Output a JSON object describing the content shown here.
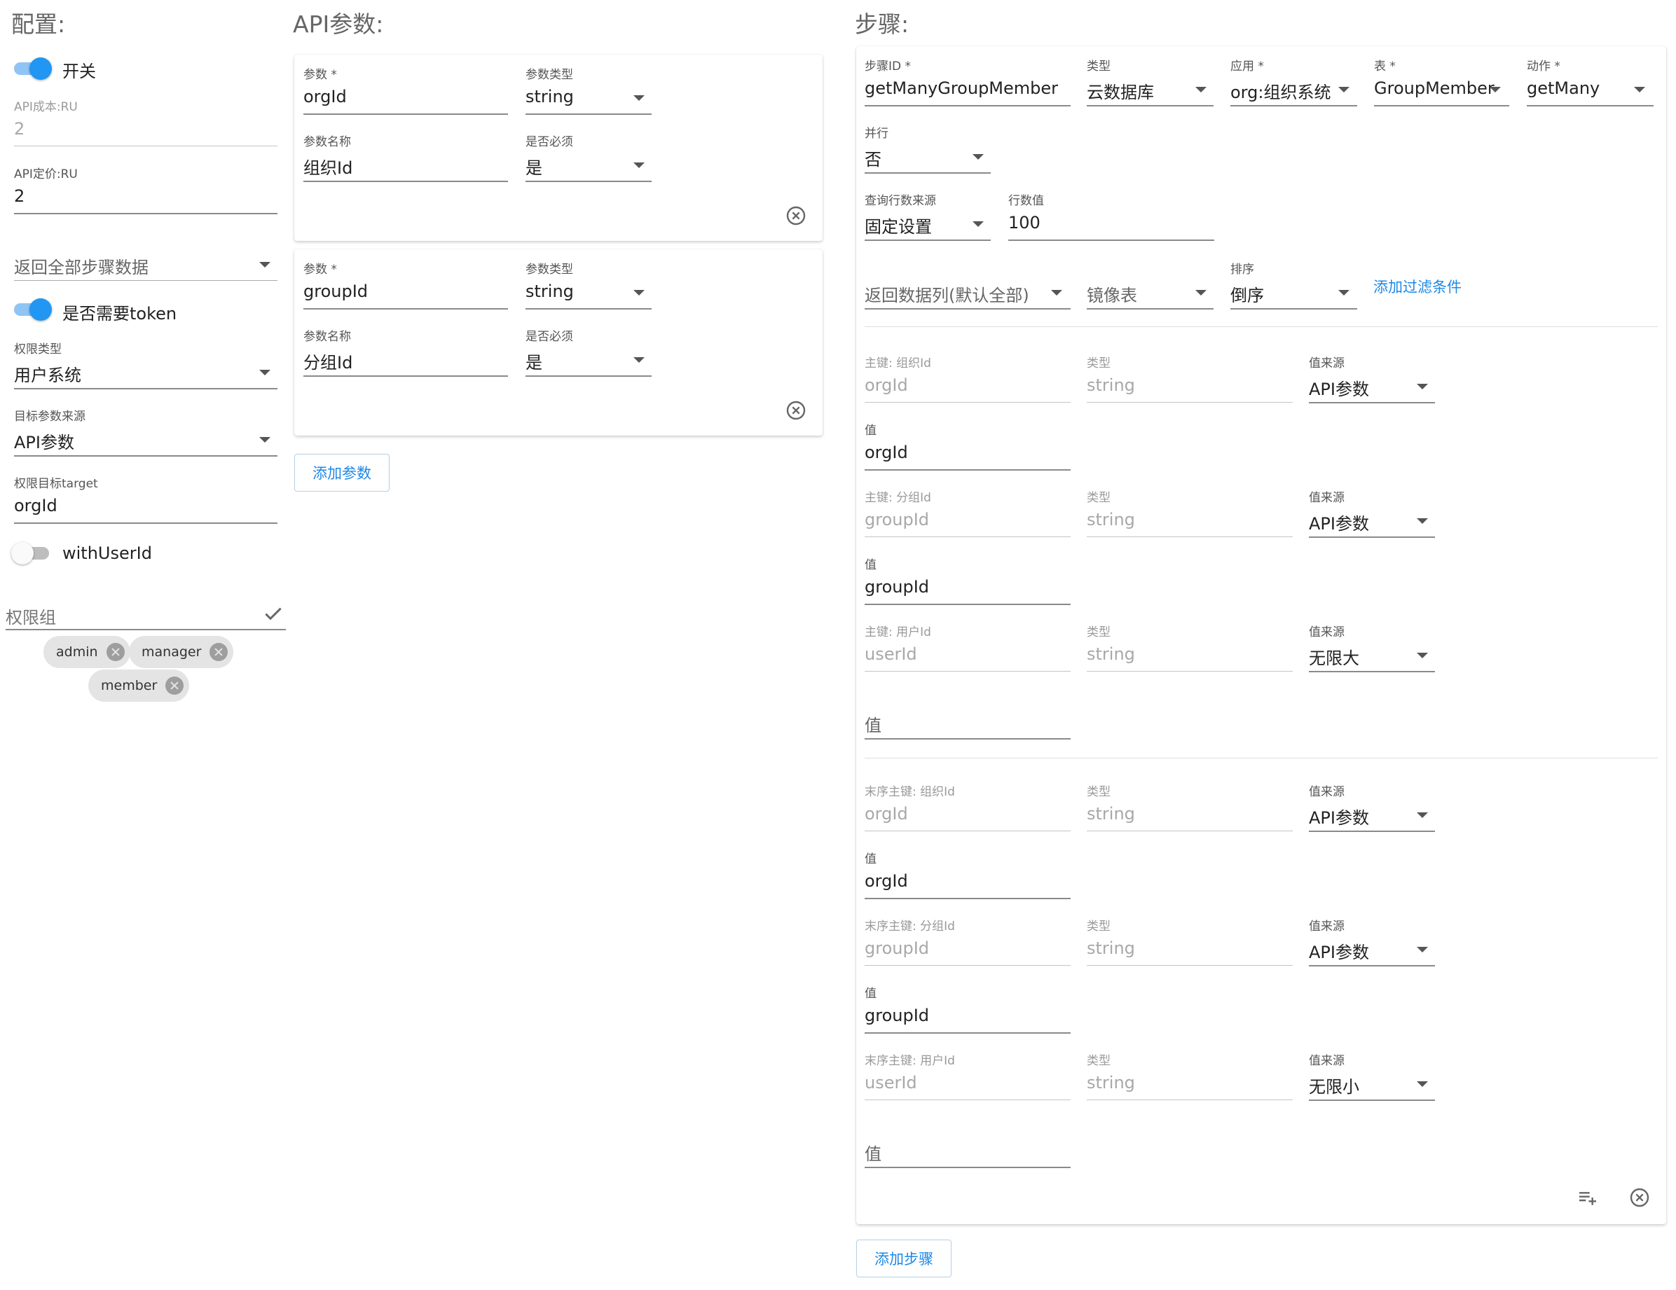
{
  "config": {
    "title": "配置:",
    "switch_label": "开关",
    "api_cost_label": "API成本:RU",
    "api_cost_value": "2",
    "api_price_label": "API定价:RU",
    "api_price_value": "2",
    "return_all_steps": "返回全部步骤数据",
    "need_token_label": "是否需要token",
    "perm_type_label": "权限类型",
    "perm_type_value": "用户系统",
    "target_source_label": "目标参数来源",
    "target_source_value": "API参数",
    "perm_target_label": "权限目标target",
    "perm_target_value": "orgId",
    "with_user_id_label": "withUserId",
    "perm_group_placeholder": "权限组",
    "perm_group_chips": [
      "admin",
      "manager",
      "member"
    ]
  },
  "api_params": {
    "title": "API参数:",
    "param_label": "参数 *",
    "type_label": "参数类型",
    "name_label": "参数名称",
    "required_label": "是否必须",
    "items": [
      {
        "param": "orgId",
        "type": "string",
        "name": "组织Id",
        "required": "是"
      },
      {
        "param": "groupId",
        "type": "string",
        "name": "分组Id",
        "required": "是"
      }
    ],
    "add_button": "添加参数"
  },
  "steps": {
    "title": "步骤:",
    "step_id_label": "步骤ID *",
    "step_id_value": "getManyGroupMember",
    "type_label": "类型",
    "type_value": "云数据库",
    "app_label": "应用 *",
    "app_value": "org:组织系统",
    "table_label": "表 *",
    "table_value": "GroupMember",
    "action_label": "动作 *",
    "action_value": "getMany",
    "parallel_label": "并行",
    "parallel_value": "否",
    "row_source_label": "查询行数来源",
    "row_source_value": "固定设置",
    "row_count_label": "行数值",
    "row_count_value": "100",
    "return_columns": "返回数据列(默认全部)",
    "mirror_table": "镜像表",
    "sort_label": "排序",
    "sort_value": "倒序",
    "add_filter": "添加过滤条件",
    "keys": [
      {
        "key_label": "主键: 组织Id",
        "key_value": "orgId",
        "type_label": "类型",
        "type_value": "string",
        "source_label": "值来源",
        "source_value": "API参数",
        "value_label": "值",
        "value": "orgId"
      },
      {
        "key_label": "主键: 分组Id",
        "key_value": "groupId",
        "type_label": "类型",
        "type_value": "string",
        "source_label": "值来源",
        "source_value": "API参数",
        "value_label": "值",
        "value": "groupId"
      },
      {
        "key_label": "主键: 用户Id",
        "key_value": "userId",
        "type_label": "类型",
        "type_value": "string",
        "source_label": "值来源",
        "source_value": "无限大",
        "value_label": "值",
        "value": ""
      },
      {
        "key_label": "末序主键: 组织Id",
        "key_value": "orgId",
        "type_label": "类型",
        "type_value": "string",
        "source_label": "值来源",
        "source_value": "API参数",
        "value_label": "值",
        "value": "orgId"
      },
      {
        "key_label": "末序主键: 分组Id",
        "key_value": "groupId",
        "type_label": "类型",
        "type_value": "string",
        "source_label": "值来源",
        "source_value": "API参数",
        "value_label": "值",
        "value": "groupId"
      },
      {
        "key_label": "末序主键: 用户Id",
        "key_value": "userId",
        "type_label": "类型",
        "type_value": "string",
        "source_label": "值来源",
        "source_value": "无限小",
        "value_label": "值",
        "value": ""
      }
    ],
    "add_button": "添加步骤"
  },
  "colors": {
    "accent": "#2196f3",
    "link": "#1e88e5"
  },
  "icons": [
    "check-icon",
    "close-circle-icon",
    "playlist-add-icon",
    "chevron-down-icon"
  ]
}
